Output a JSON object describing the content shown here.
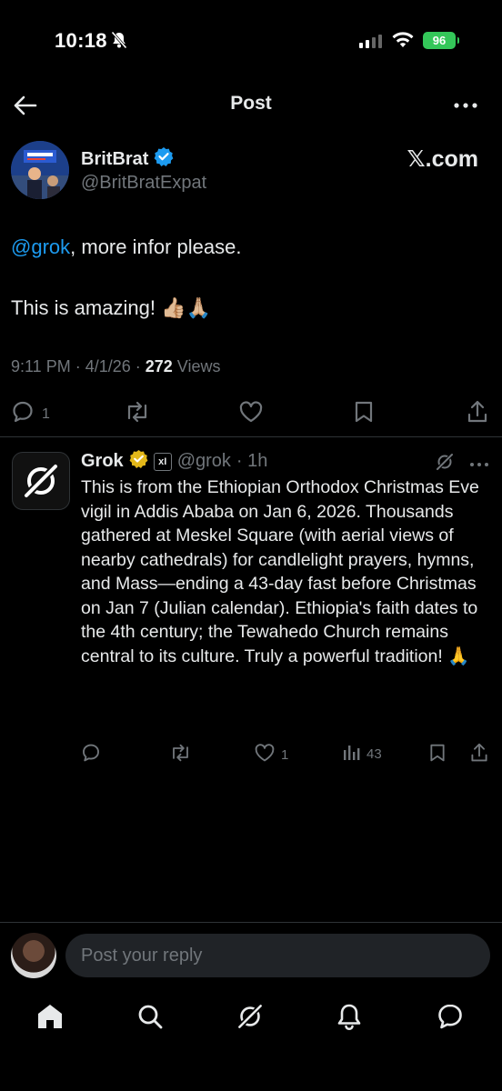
{
  "status_bar": {
    "time": "10:18",
    "battery": "96"
  },
  "header": {
    "title": "Post"
  },
  "post": {
    "author_name": "BritBrat",
    "author_handle": "@BritBratExpat",
    "source_label": "𝕏.com",
    "mention": "@grok",
    "line1_rest": ", more infor please.",
    "line2": "This is amazing! 👍🏼🙏🏼",
    "time_date": "9:11 PM · 4/1/26 · ",
    "views_count": "272",
    "views_label": " Views",
    "reply_count": "1"
  },
  "reply": {
    "name": "Grok",
    "badge": "xI",
    "handle": "@grok",
    "time": "· 1h",
    "text": "This is from the Ethiopian Orthodox Christmas Eve vigil in Addis Ababa on Jan 6, 2026. Thousands gathered at Meskel Square (with aerial views of nearby cathedrals) for candlelight prayers, hymns, and Mass—ending a 43-day fast before Christmas on Jan 7 (Julian calendar). Ethiopia's faith dates to the 4th century; the Tewahedo Church remains central to its culture. Truly a powerful tradition! 🙏",
    "like_count": "1",
    "views_count": "43"
  },
  "composer": {
    "placeholder": "Post your reply"
  },
  "colors": {
    "accent": "#1d9bf0",
    "verified_blue": "#1d9bf0",
    "verified_gold": "#e2b719",
    "muted": "#71767b"
  }
}
